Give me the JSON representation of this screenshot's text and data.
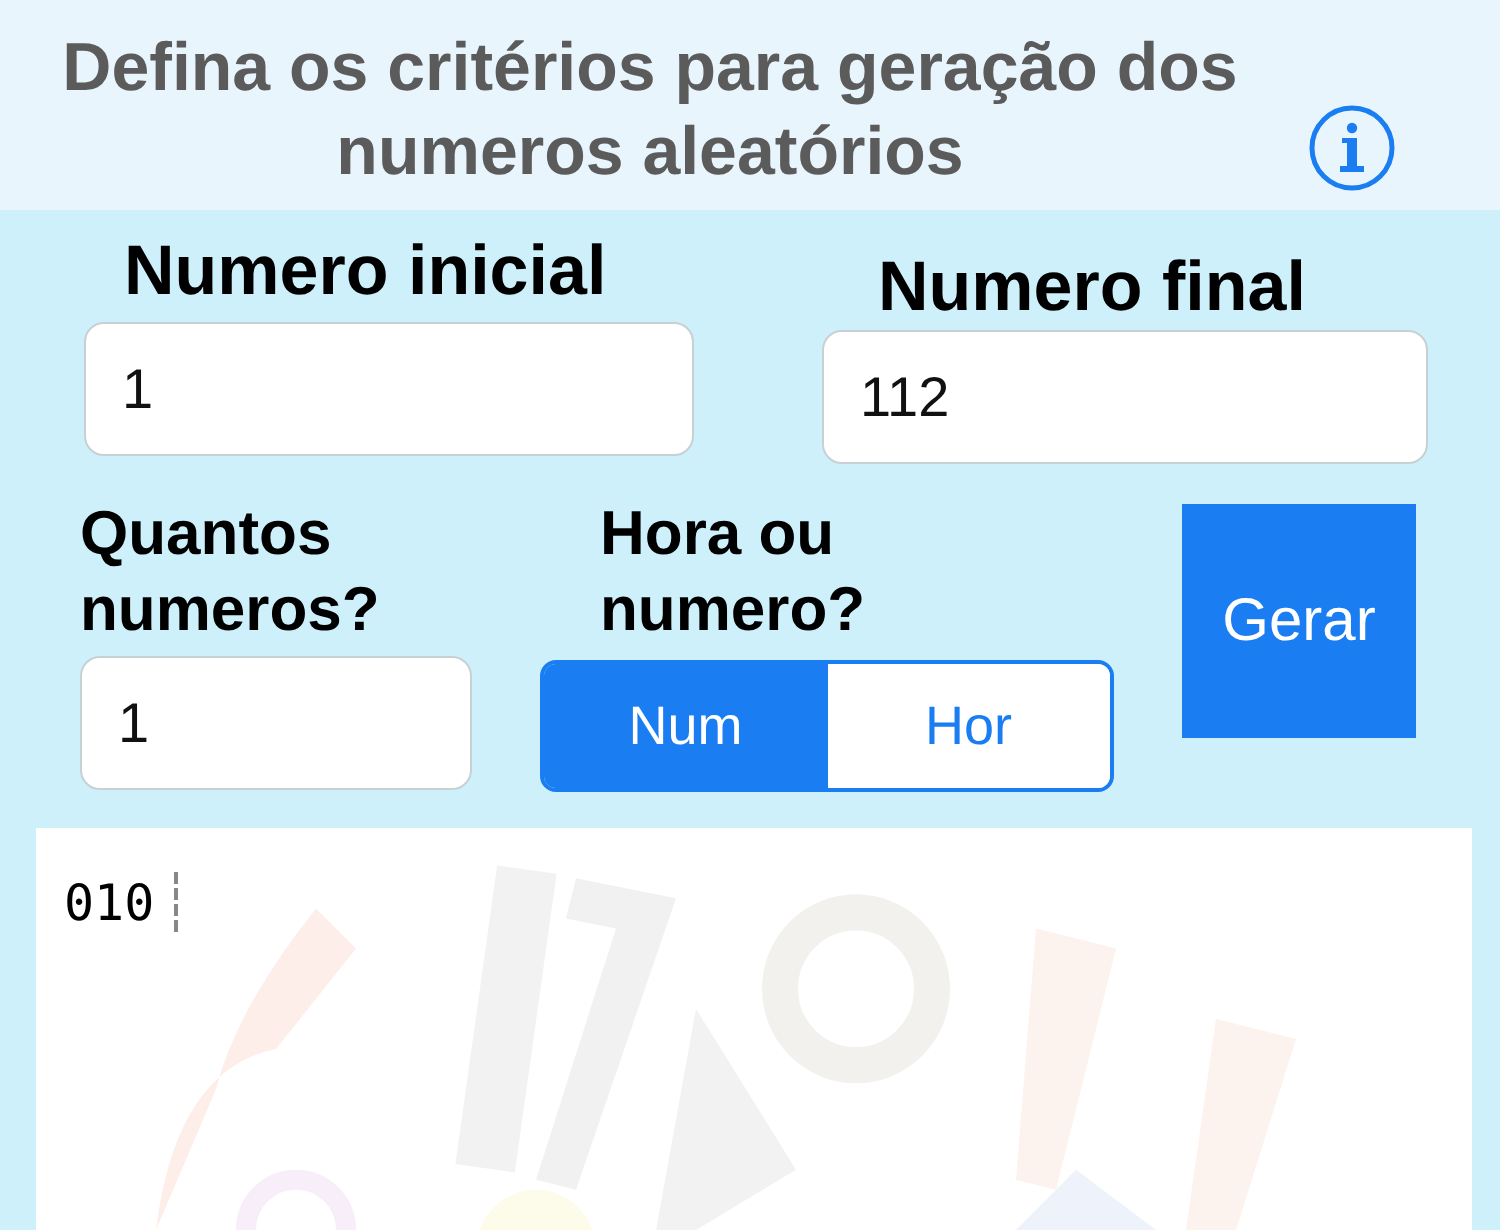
{
  "header": {
    "title": "Defina os critérios para geração dos numeros aleatórios"
  },
  "fields": [
    {
      "label": "Numero inicial",
      "value": "1"
    },
    {
      "label": "Numero final",
      "value": "112"
    },
    {
      "label": "Quantos numeros?",
      "value": "1"
    }
  ],
  "mode": {
    "label": "Hora ou numero?",
    "options": [
      {
        "label": "Num",
        "selected": true
      },
      {
        "label": "Hor",
        "selected": false
      }
    ]
  },
  "generate_button": "Gerar",
  "output": {
    "text": "010"
  }
}
